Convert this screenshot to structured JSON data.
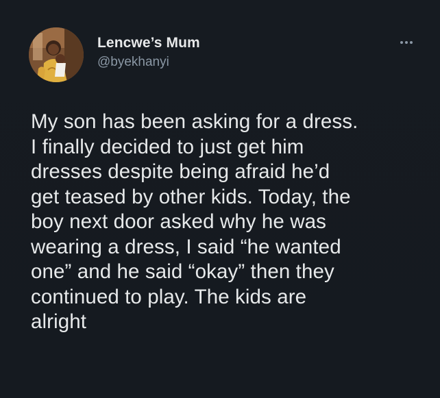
{
  "tweet": {
    "author": {
      "display_name": "Lencwe’s Mum",
      "handle": "@byekhanyi",
      "avatar_icon": "profile-photo"
    },
    "more_icon": "more-horizontal-icon",
    "text": "My son has been asking for a dress.\nI finally decided to just get him\ndresses despite being afraid he’d\nget teased by other kids. Today, the\nboy next door asked why he was\nwearing a dress, I said “he wanted\none” and he said “okay” then they\ncontinued to play. The kids are\nalright"
  },
  "colors": {
    "background": "#161b21",
    "text_primary": "#e7e9ea",
    "text_secondary": "#8b98a5"
  }
}
